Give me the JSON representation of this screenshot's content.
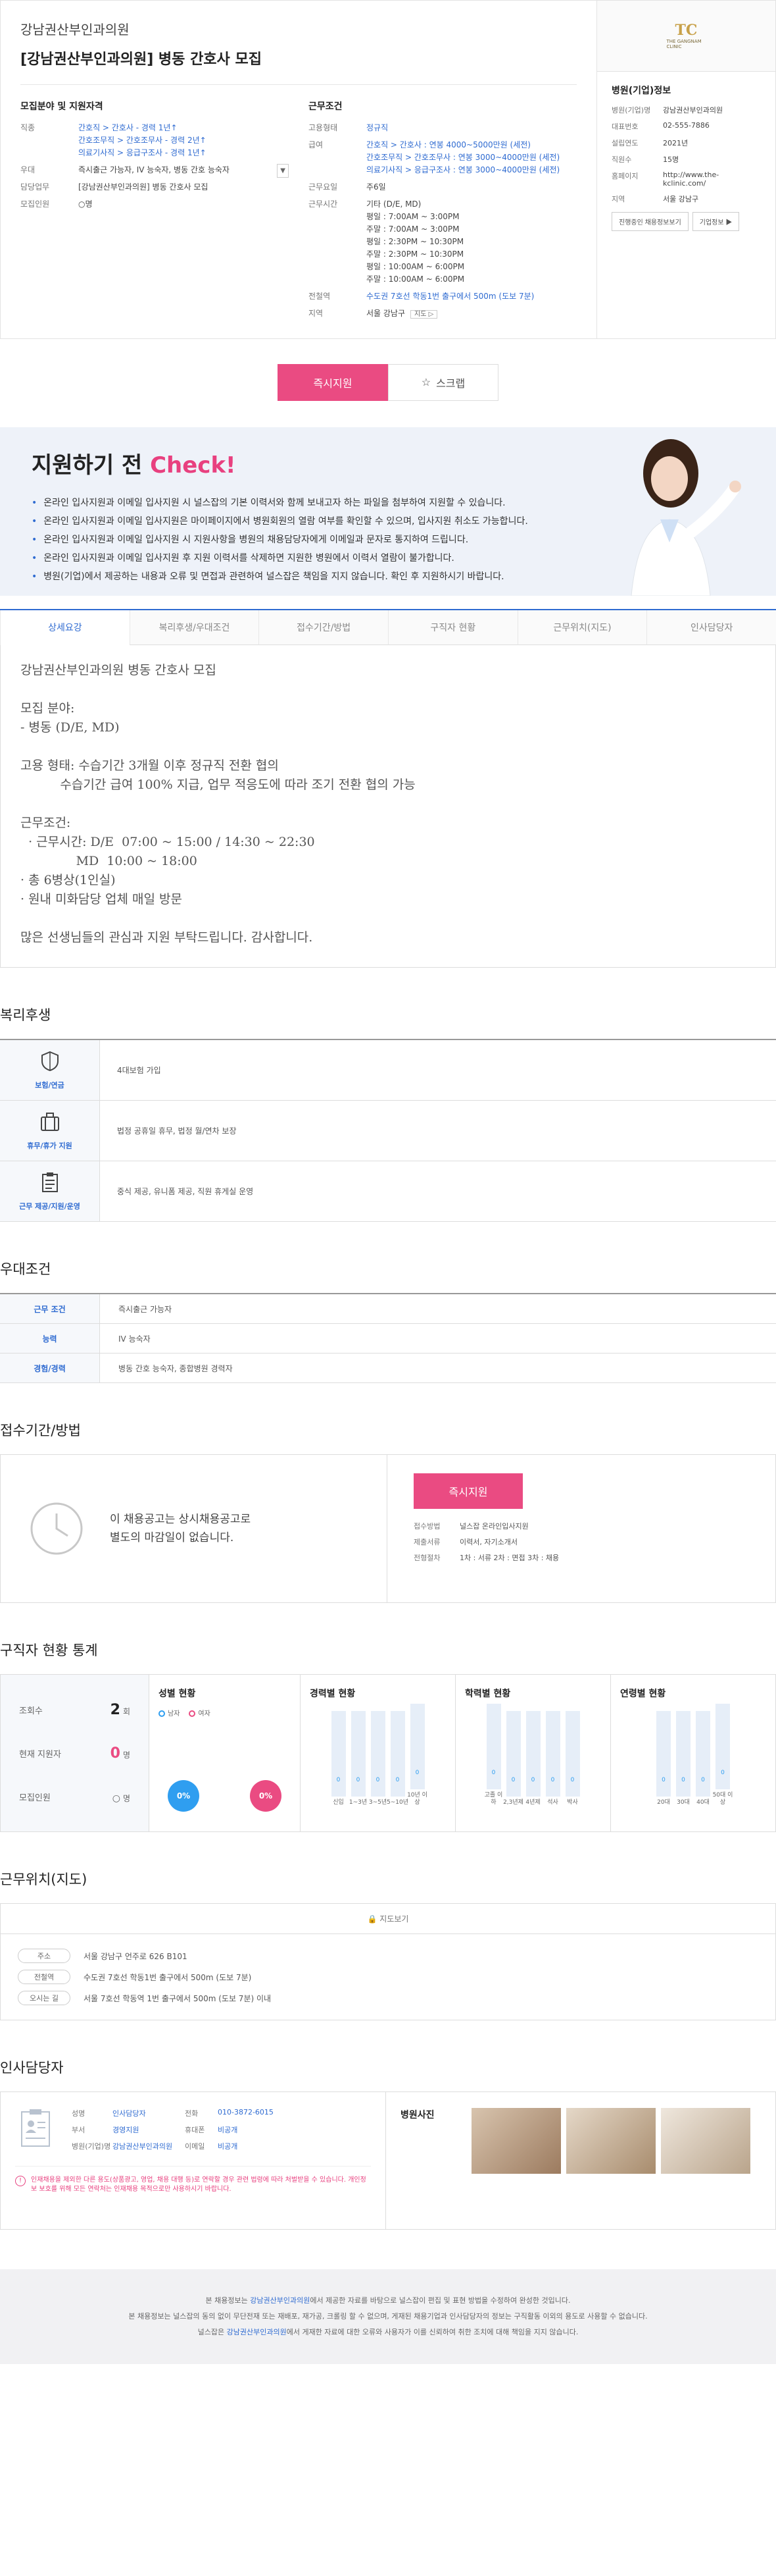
{
  "header": {
    "hospital": "강남권산부인과의원",
    "title": "[강남권산부인과의원] 병동 간호사 모집"
  },
  "recruit": {
    "heading": "모집분야 및 지원자격",
    "rows": [
      {
        "k": "직종",
        "v": [
          "간호직 > 간호사 - 경력 1년↑",
          "간호조무직 > 간호조무사 - 경력 2년↑",
          "의료기사직 > 응급구조사 - 경력 1년↑"
        ]
      },
      {
        "k": "우대",
        "v": [
          "즉시출근 가능자, IV 능숙자, 병동 간호 능숙자"
        ]
      },
      {
        "k": "담당업무",
        "v": [
          "[강남권산부인과의원] 병동 간호사 모집"
        ]
      },
      {
        "k": "모집인원",
        "v": [
          "○명"
        ]
      }
    ],
    "more": "▼"
  },
  "work": {
    "heading": "근무조건",
    "rows": [
      {
        "k": "고용형태",
        "v": [
          "정규직"
        ]
      },
      {
        "k": "급여",
        "v": [
          "간호직 > 간호사 : 연봉 4000~5000만원 (세전)",
          "간호조무직 > 간호조무사 : 연봉 3000~4000만원 (세전)",
          "의료기사직 > 응급구조사 : 연봉 3000~4000만원 (세전)"
        ]
      },
      {
        "k": "근무요일",
        "v": [
          "주6일"
        ]
      },
      {
        "k": "근무시간",
        "v": [
          "기타 (D/E, MD)",
          "평일 : 7:00AM ~ 3:00PM",
          "주말 : 7:00AM ~ 3:00PM",
          "평일 : 2:30PM ~ 10:30PM",
          "주말 : 2:30PM ~ 10:30PM",
          "평일 : 10:00AM ~ 6:00PM",
          "주말 : 10:00AM ~ 6:00PM"
        ]
      },
      {
        "k": "전철역",
        "v": [
          "수도권 7호선 학동1번 출구에서 500m (도보 7분)"
        ]
      },
      {
        "k": "지역",
        "v": [
          "서울 강남구"
        ]
      }
    ],
    "map_btn": "지도 ▷"
  },
  "hospital_info": {
    "heading": "병원(기업)정보",
    "rows": [
      {
        "k": "병원(기업)명",
        "v": "강남권산부인과의원"
      },
      {
        "k": "대표번호",
        "v": "02-555-7886"
      },
      {
        "k": "설립연도",
        "v": "2021년"
      },
      {
        "k": "직원수",
        "v": "15명"
      },
      {
        "k": "홈페이지",
        "v": "http://www.the-kclinic.com/"
      },
      {
        "k": "지역",
        "v": "서울 강남구"
      }
    ],
    "btn_jobs": "진행중인 채용정보보기",
    "btn_info": "기업정보 ▶",
    "logo_mark": "TC",
    "logo_text": "THE GANGNAM CLINIC"
  },
  "actions": {
    "apply": "즉시지원",
    "scrap": "스크랩"
  },
  "check": {
    "title_a": "지원하기 전 ",
    "title_b": "Check!",
    "items": [
      "온라인 입사지원과 이메일 입사지원 시 널스잡의 기본 이력서와 함께 보내고자 하는 파일을 첨부하여 지원할 수 있습니다.",
      "온라인 입사지원과 이메일 입사지원은 마이페이지에서 병원회원의 열람 여부를 확인할 수 있으며, 입사지원 취소도 가능합니다.",
      "온라인 입사지원과 이메일 입사지원 시 지원사항을 병원의 채용담당자에게 이메일과 문자로 통지하여 드립니다.",
      "온라인 입사지원과 이메일 입사지원 후 지원 이력서를 삭제하면 지원한 병원에서 이력서 열람이 불가합니다.",
      "병원(기업)에서 제공하는 내용과 오류 및 면접과 관련하여 널스잡은 책임을 지지 않습니다. 확인 후 지원하시기 바랍니다."
    ]
  },
  "tabs": [
    "상세요강",
    "복리후생/우대조건",
    "접수기간/방법",
    "구직자 현황",
    "근무위치(지도)",
    "인사담당자"
  ],
  "detail": {
    "lines": [
      "강남권산부인과의원 병동 간호사 모집",
      "",
      "모집 분야:",
      "- 병동 (D/E, MD)",
      "",
      "고용 형태: 수습기간 3개월 이후 정규직 전환 협의",
      "          수습기간 급여 100% 지급, 업무 적응도에 따라 조기 전환 협의 가능",
      "",
      "근무조건:",
      "  · 근무시간: D/E  07:00 ~ 15:00 / 14:30 ~ 22:30",
      "              MD  10:00 ~ 18:00",
      "· 총 6병상(1인실)",
      "· 원내 미화담당 업체 매일 방문",
      "",
      "많은 선생님들의 관심과 지원 부탁드립니다. 감사합니다."
    ]
  },
  "benefits": {
    "title": "복리후생",
    "rows": [
      {
        "label": "보험/연금",
        "icon": "shield-icon",
        "text": "4대보험 가입"
      },
      {
        "label": "휴무/휴가 지원",
        "icon": "suitcase-icon",
        "text": "법정 공휴일 휴무, 법정 월/연차 보장"
      },
      {
        "label": "근무 제공/지원/운영",
        "icon": "clipboard-icon",
        "text": "중식 제공, 유니폼 제공, 직원 휴게실 운영"
      }
    ]
  },
  "preferred": {
    "title": "우대조건",
    "rows": [
      {
        "k": "근무 조건",
        "v": "즉시출근 가능자"
      },
      {
        "k": "능력",
        "v": "IV 능숙자"
      },
      {
        "k": "경험/경력",
        "v": "병동 간호 능숙자, 종합병원 경력자"
      }
    ]
  },
  "method": {
    "title": "접수기간/방법",
    "msg1": "이 채용공고는 상시채용공고로",
    "msg2": "별도의 마감일이 없습니다.",
    "apply": "즉시지원",
    "rows": [
      {
        "k": "접수방법",
        "v": "널스잡 온라인입사지원"
      },
      {
        "k": "제출서류",
        "v": "이력서, 자기소개서"
      },
      {
        "k": "전형절차",
        "v": "1차 : 서류    2차 : 면접    3차 : 채용"
      }
    ]
  },
  "stats": {
    "title": "구직자 현황 통계",
    "list": [
      {
        "k": "조회수",
        "v": "2",
        "unit": "회"
      },
      {
        "k": "현재 지원자",
        "v": "0",
        "unit": "명"
      },
      {
        "k": "모집인원",
        "v": "○",
        "unit": "명"
      }
    ],
    "gender": {
      "title": "성별 현황",
      "male": "남자",
      "female": "여자",
      "male_pct": "0%",
      "female_pct": "0%"
    },
    "career": {
      "title": "경력별 현황",
      "cats": [
        "신입",
        "1~3년",
        "3~5년",
        "5~10년",
        "10년 이상"
      ],
      "values": [
        0,
        0,
        0,
        0,
        0
      ]
    },
    "edu": {
      "title": "학력별 현황",
      "cats": [
        "고졸 이하",
        "2,3년제",
        "4년제",
        "석사",
        "박사"
      ],
      "values": [
        0,
        0,
        0,
        0,
        0
      ]
    },
    "age": {
      "title": "연령별 현황",
      "cats": [
        "20대",
        "30대",
        "40대",
        "50대 이상"
      ],
      "values": [
        0,
        0,
        0,
        0
      ]
    },
    "pct_label": "0"
  },
  "location": {
    "title": "근무위치(지도)",
    "map_link": "지도보기",
    "rows": [
      {
        "k": "주소",
        "v": "서울 강남구 언주로 626 B101"
      },
      {
        "k": "전철역",
        "v": "수도권 7호선 학동1번 출구에서 500m (도보 7분)"
      },
      {
        "k": "오시는 길",
        "v": "서울 7호선 학동역 1번 출구에서 500m (도보 7분) 이내"
      }
    ]
  },
  "hr": {
    "title": "인사담당자",
    "grid": [
      [
        "성명",
        "인사담당자",
        "전화",
        "010-3872-6015"
      ],
      [
        "부서",
        "경영지원",
        "휴대폰",
        "비공개"
      ],
      [
        "병원(기업)명",
        "강남권산부인과의원",
        "이메일",
        "비공개"
      ]
    ],
    "warn": "인재채용을 제외한 다른 용도(상품광고, 영업, 채용 대행 등)로 연락할 경우 관련 법령에 따라 처벌받을 수 있습니다. 개인정보 보호를 위해 모든 연락처는 인재채용 목적으로만 사용하시기 바랍니다.",
    "photos_title": "병원사진"
  },
  "footer": {
    "l1a": "본 채용정보는 ",
    "l1b": "강남권산부인과의원",
    "l1c": "에서 제공한 자료를 바탕으로 널스잡이 편집 및 표현 방법을 수정하여 완성한 것입니다.",
    "l2": "본 채용정보는 널스잡의 동의 없이 무단전재 또는 재배포, 재가공, 크롤링 할 수 없으며, 게재된 채용기업과 인사담당자의 정보는 구직활동 이외의 용도로 사용할 수 없습니다.",
    "l3a": "널스잡은 ",
    "l3b": "강남권산부인과의원",
    "l3c": "에서 게재한 자료에 대한 오류와 사용자가 이를 신뢰하여 취한 조치에 대해 책임을 지지 않습니다."
  }
}
